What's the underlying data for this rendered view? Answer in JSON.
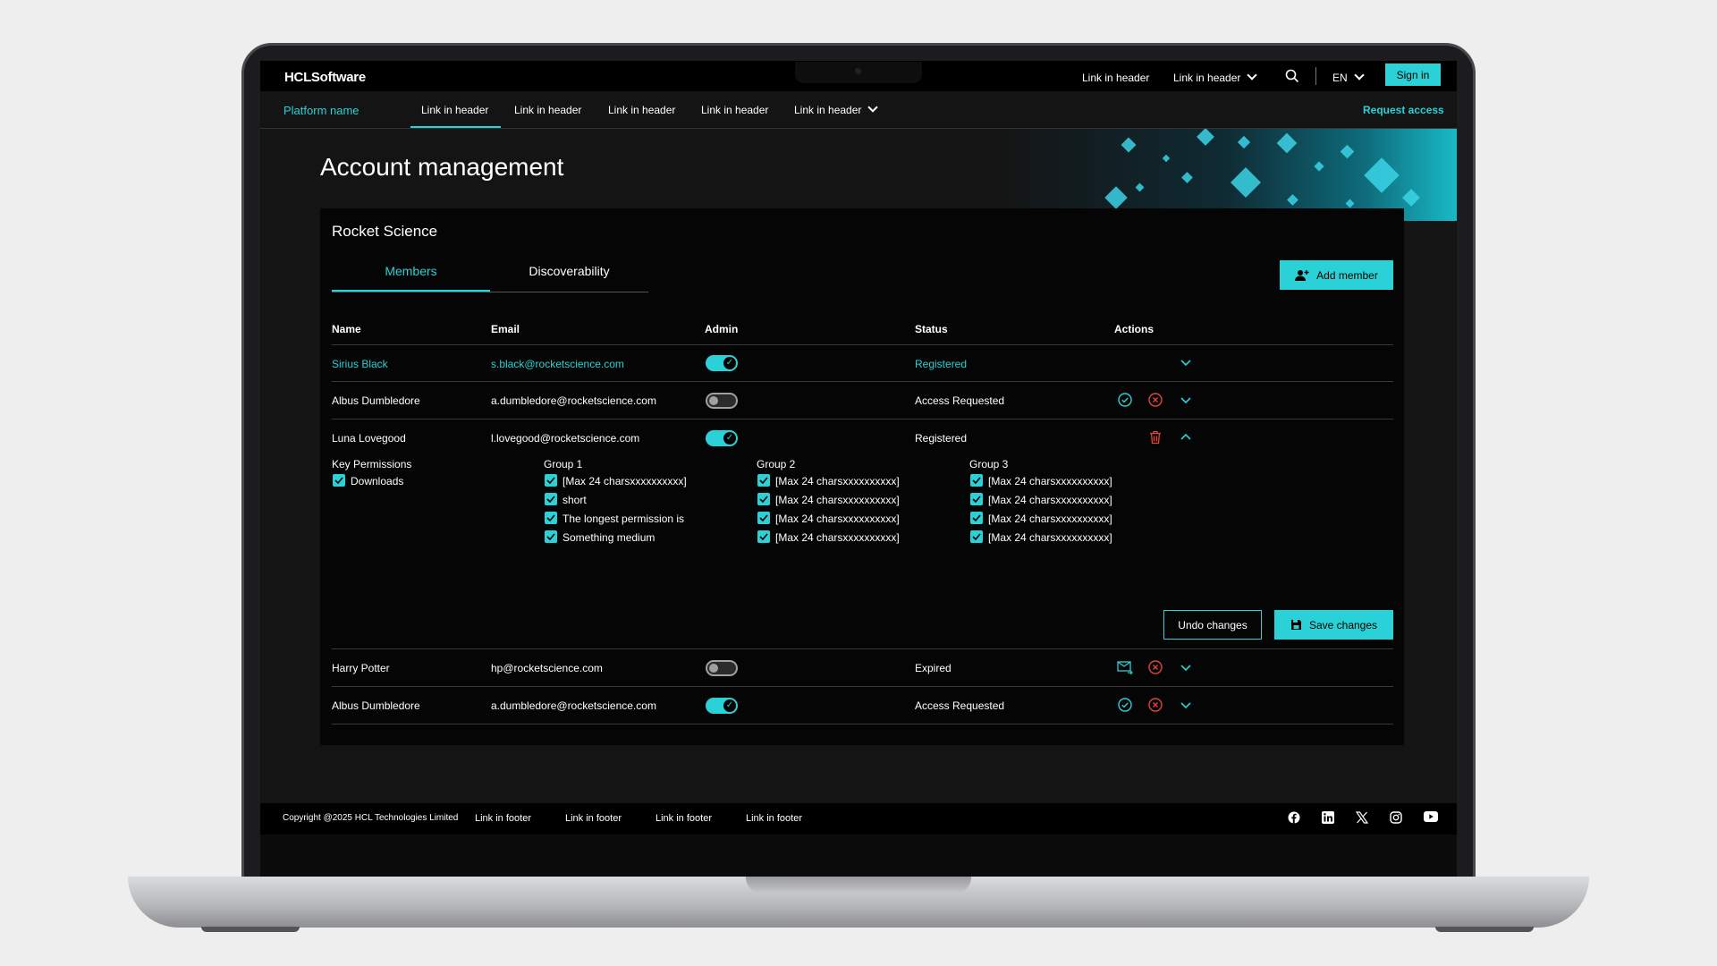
{
  "header": {
    "logo": "HCLSoftware",
    "links": [
      "Link in header",
      "Link in header"
    ],
    "language": "EN",
    "sign_in": "Sign in"
  },
  "subnav": {
    "platform_name": "Platform name",
    "links": [
      "Link in header",
      "Link in header",
      "Link in header",
      "Link in header",
      "Link in header"
    ],
    "request_access": "Request access"
  },
  "page": {
    "title": "Account management",
    "org_name": "Rocket Science",
    "tabs": [
      "Members",
      "Discoverability"
    ],
    "add_member": "Add member"
  },
  "table": {
    "headers": [
      "Name",
      "Email",
      "Admin",
      "Status",
      "Actions"
    ],
    "rows": [
      {
        "name": "Sirius Black",
        "email": "s.black@rocketscience.com",
        "admin": true,
        "status": "Registered"
      },
      {
        "name": "Albus Dumbledore",
        "email": "a.dumbledore@rocketscience.com",
        "admin": false,
        "status": "Access Requested"
      },
      {
        "name": "Luna Lovegood",
        "email": "l.lovegood@rocketscience.com",
        "admin": true,
        "status": "Registered"
      },
      {
        "name": "Harry Potter",
        "email": "hp@rocketscience.com",
        "admin": false,
        "status": "Expired"
      },
      {
        "name": "Albus Dumbledore",
        "email": "a.dumbledore@rocketscience.com",
        "admin": true,
        "status": "Access Requested"
      }
    ]
  },
  "permissions": {
    "key_title": "Key Permissions",
    "key_items": [
      "Downloads"
    ],
    "groups": [
      {
        "title": "Group 1",
        "items": [
          "[Max 24 charsxxxxxxxxxx]",
          "short",
          "The longest permission is",
          "Something medium"
        ]
      },
      {
        "title": "Group 2",
        "items": [
          "[Max 24 charsxxxxxxxxxx]",
          "[Max 24 charsxxxxxxxxxx]",
          "[Max 24 charsxxxxxxxxxx]",
          "[Max 24 charsxxxxxxxxxx]"
        ]
      },
      {
        "title": "Group 3",
        "items": [
          "[Max 24 charsxxxxxxxxxx]",
          "[Max 24 charsxxxxxxxxxx]",
          "[Max 24 charsxxxxxxxxxx]",
          "[Max 24 charsxxxxxxxxxx]"
        ]
      }
    ],
    "undo": "Undo changes",
    "save": "Save changes"
  },
  "footer": {
    "copyright": "Copyright @2025 HCL Technologies Limited",
    "links": [
      "Link in footer",
      "Link in footer",
      "Link in footer",
      "Link in footer"
    ],
    "social_icons": [
      "facebook-icon",
      "linkedin-icon",
      "x-icon",
      "instagram-icon",
      "youtube-icon"
    ]
  },
  "colors": {
    "accent": "#2ad1d6",
    "danger": "#e0453c",
    "background": "#141414"
  }
}
